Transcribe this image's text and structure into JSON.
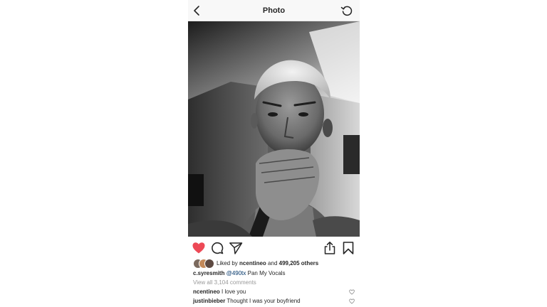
{
  "header": {
    "title": "Photo",
    "back_icon": "chevron-left-icon",
    "refresh_icon": "refresh-icon"
  },
  "actions": {
    "like_icon": "heart-filled-icon",
    "like_color": "#ed4956",
    "comment_icon": "comment-icon",
    "share_icon": "paper-plane-icon",
    "upload_icon": "upload-icon",
    "save_icon": "bookmark-icon"
  },
  "likes": {
    "prefix": "Liked by",
    "user": "ncentineo",
    "middle": "and",
    "count": "499,205 others"
  },
  "caption": {
    "username": "c.syresmith",
    "mention": "@490tx",
    "text": "Pan My Vocals"
  },
  "comments_link": "View all 3,104 comments",
  "comments": [
    {
      "username": "ncentineo",
      "text": "I love you"
    },
    {
      "username": "justinbieber",
      "text": "Thought I was your boyfriend"
    }
  ]
}
